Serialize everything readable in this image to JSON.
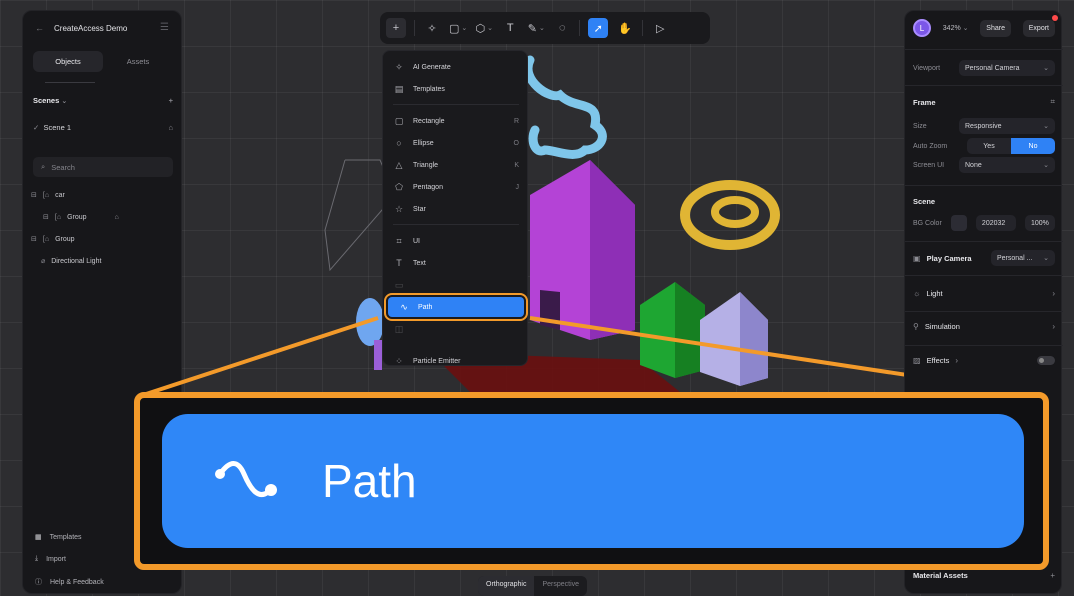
{
  "app": {
    "project_title": "CreateAccess Demo"
  },
  "left_panel": {
    "tabs": [
      {
        "label": "Objects"
      },
      {
        "label": "Assets"
      }
    ],
    "scenes_header": "Scenes",
    "scene_name": "Scene 1",
    "search_placeholder": "Search",
    "tree": [
      {
        "label": "car"
      },
      {
        "label": "Group"
      },
      {
        "label": "Group"
      },
      {
        "label": "Directional Light"
      }
    ],
    "bottom_links": [
      {
        "label": "Templates"
      },
      {
        "label": "Import"
      },
      {
        "label": "Help & Feedback"
      }
    ]
  },
  "add_menu": {
    "items": [
      {
        "label": "AI Generate",
        "icon": "sparkle-icon"
      },
      {
        "label": "Templates",
        "icon": "template-icon"
      },
      {
        "label": "Rectangle",
        "key": "R",
        "icon": "square-icon"
      },
      {
        "label": "Ellipse",
        "key": "O",
        "icon": "circle-icon"
      },
      {
        "label": "Triangle",
        "key": "K",
        "icon": "triangle-icon"
      },
      {
        "label": "Pentagon",
        "key": "J",
        "icon": "pentagon-icon"
      },
      {
        "label": "Star",
        "icon": "star-icon"
      },
      {
        "label": "UI",
        "icon": "ui-icon"
      },
      {
        "label": "Text",
        "icon": "text-icon"
      },
      {
        "label": "Path",
        "icon": "path-icon"
      },
      {
        "label": "Particle Emitter",
        "icon": "particles-icon"
      }
    ]
  },
  "right_panel": {
    "avatar_initial": "L",
    "zoom": "342%",
    "share_label": "Share",
    "export_label": "Export",
    "viewport_label": "Viewport",
    "viewport_value": "Personal Camera",
    "frame_heading": "Frame",
    "size_label": "Size",
    "size_value": "Responsive",
    "auto_zoom_label": "Auto Zoom",
    "auto_zoom_yes": "Yes",
    "auto_zoom_no": "No",
    "screen_ui_label": "Screen UI",
    "screen_ui_value": "None",
    "scene_heading": "Scene",
    "bg_color_label": "BG Color",
    "bg_color_hex": "202032",
    "bg_color_opacity": "100%",
    "play_camera_label": "Play Camera",
    "play_camera_value": "Personal ...",
    "light_label": "Light",
    "simulation_label": "Simulation",
    "effects_label": "Effects",
    "material_assets_label": "Material Assets"
  },
  "view_toggle": {
    "orthographic": "Orthographic",
    "perspective": "Perspective"
  },
  "callout": {
    "label": "Path"
  },
  "colors": {
    "accent": "#2f82f5",
    "highlight_border": "#f39a2a",
    "panel": "#17171a"
  }
}
